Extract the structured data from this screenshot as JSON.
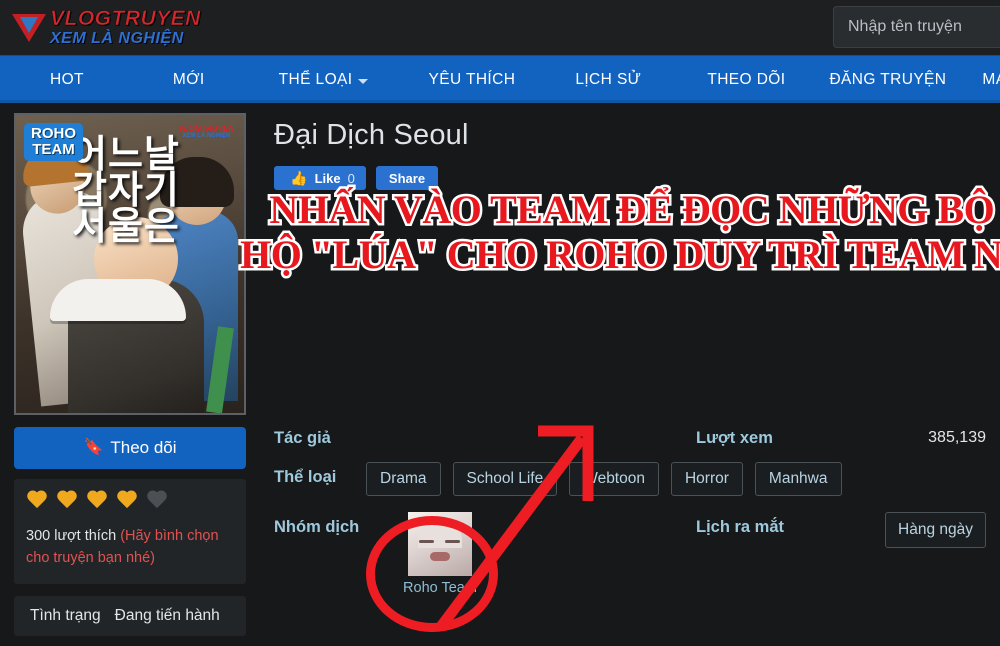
{
  "header": {
    "logo": {
      "top": "VLOGTRUYEN",
      "bottom": "XEM LÀ NGHIỆN",
      "mark_icon": "play-triangle-icon"
    },
    "search": {
      "placeholder": "Nhập tên truyện",
      "value": ""
    }
  },
  "nav": {
    "items": [
      {
        "label": "HOT",
        "has_caret": false
      },
      {
        "label": "MỚI",
        "has_caret": false
      },
      {
        "label": "THỂ LOẠI",
        "has_caret": true
      },
      {
        "label": "YÊU THÍCH",
        "has_caret": false
      },
      {
        "label": "LỊCH SỬ",
        "has_caret": false
      },
      {
        "label": "THEO DÕI",
        "has_caret": false
      },
      {
        "label": "ĐĂNG TRUYỆN",
        "has_caret": false
      },
      {
        "label": "MA",
        "has_caret": false
      }
    ],
    "bg_color": "#1263c0"
  },
  "cover": {
    "badge": "ROHO\nTEAM",
    "badge_line1": "ROHO",
    "badge_line2": "TEAM",
    "korean_title": "어느날\n갑자기\n서울은",
    "watermark_top": "VLOGTRUYEN",
    "watermark_bottom": "XEM LÀ NGHIỆN"
  },
  "sidebar": {
    "follow_label": "Theo dõi",
    "follow_icon": "bookmark-icon",
    "rating": {
      "filled": 4,
      "total": 5,
      "filled_color": "#f0a81e",
      "empty_color": "#4c5054"
    },
    "likes_count_text": "300 lượt thích",
    "likes_note": "(Hãy bình chọn cho truyện bạn nhé)",
    "status_label": "Tình trạng",
    "status_value": "Đang tiến hành"
  },
  "main": {
    "title": "Đại Dịch Seoul",
    "like_button": {
      "label": "Like",
      "count": "0",
      "icon": "thumbs-up-icon"
    },
    "share_button": {
      "label": "Share"
    },
    "announcement": {
      "line1": "NHẤN VÀO TEAM ĐỂ ĐỌC NHỮNG BỘ KHÁC ỦNG",
      "line2": "HỘ \"LÚA\" CHO ROHO DUY TRÌ TEAM NHA CẢ NHÀ!!",
      "color": "#e8181f",
      "outline_color": "#ffffff"
    },
    "info": {
      "author_label": "Tác giả",
      "author_value": "",
      "views_label": "Lượt xem",
      "views_value": "385,139",
      "genres_label": "Thể loại",
      "genres": [
        "Drama",
        "School Life",
        "Webtoon",
        "Horror",
        "Manhwa"
      ],
      "group_label": "Nhóm dịch",
      "group_name": "Roho Team",
      "schedule_label": "Lịch ra mắt",
      "schedule_value": "Hàng ngày"
    },
    "annotations": {
      "circle_target": "Roho Team avatar",
      "arrow_color": "#ee1c23"
    }
  }
}
